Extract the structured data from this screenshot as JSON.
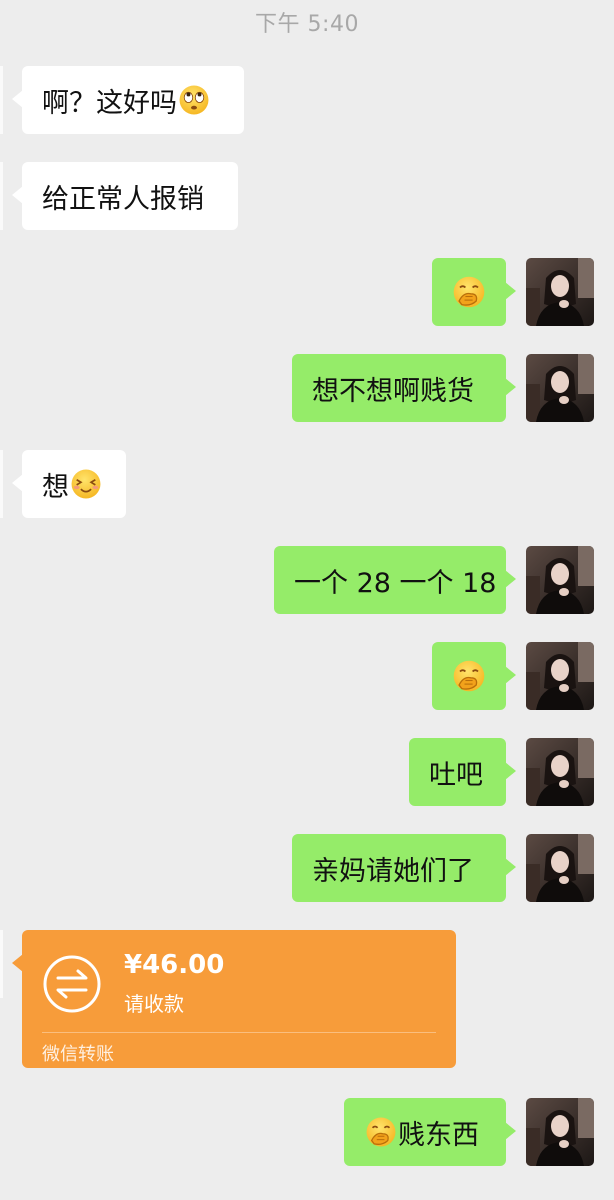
{
  "chat": {
    "timestamp": "下午 5:40",
    "messages": [
      {
        "side": "in",
        "text": "啊？这好吗",
        "emoji": "rolling-eyes-emoji"
      },
      {
        "side": "in",
        "text": "给正常人报销"
      },
      {
        "side": "out",
        "text": "",
        "emoji": "covering-mouth-emoji"
      },
      {
        "side": "out",
        "text": "想不想啊贱货"
      },
      {
        "side": "in",
        "text": "想",
        "emoji": "blushing-smile-emoji"
      },
      {
        "side": "out",
        "text": "一个 28 一个 18"
      },
      {
        "side": "out",
        "text": "",
        "emoji": "covering-mouth-emoji"
      },
      {
        "side": "out",
        "text": "吐吧"
      },
      {
        "side": "out",
        "text": "亲妈请她们了"
      },
      {
        "side": "out",
        "text": "贱东西",
        "emoji": "covering-mouth-emoji"
      }
    ],
    "transfer": {
      "amount": "¥46.00",
      "status": "请收款",
      "footer": "微信转账",
      "color": "#f79c3a"
    }
  },
  "colors": {
    "background": "#ededed",
    "incoming_bubble": "#ffffff",
    "outgoing_bubble": "#95ec69"
  }
}
